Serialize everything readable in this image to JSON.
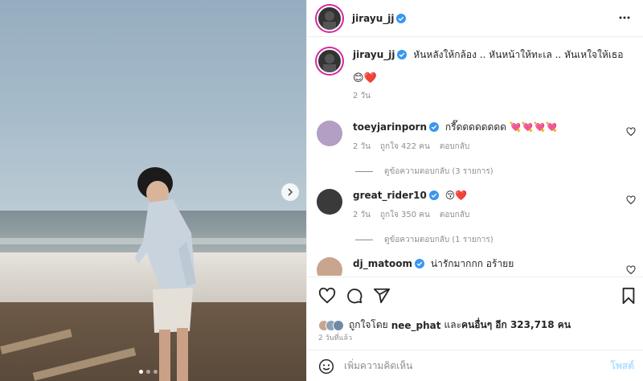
{
  "post": {
    "author": "jirayu_jj",
    "caption": "หันหลังให้กล้อง .. หันหน้าให้ทะเล .. หันเหใจให้เธอ",
    "caption_emojis": "😊❤️",
    "caption_time": "2 วัน",
    "carousel_dots": 3,
    "carousel_active": 1
  },
  "comments": [
    {
      "user": "toeyjarinporn",
      "text": "กรี๊ดดดดดดดด 💘💘💘💘",
      "time": "2 วัน",
      "likes": "ถูกใจ 422 คน",
      "reply": "ตอบกลับ",
      "view_replies": "ดูข้อความตอบกลับ (3 รายการ)"
    },
    {
      "user": "great_rider10",
      "text": "😚❤️",
      "time": "2 วัน",
      "likes": "ถูกใจ 350 คน",
      "reply": "ตอบกลับ",
      "view_replies": "ดูข้อความตอบกลับ (1 รายการ)"
    },
    {
      "user": "dj_matoom",
      "text": "น่ารักมากกก อร้ายย"
    }
  ],
  "likes_summary": {
    "prefix": "ถูกใจโดย",
    "user": "nee_phat",
    "middle": "และ",
    "others": "คนอื่นๆ อีก 323,718 คน"
  },
  "time_ago": "2 วันที่แล้ว",
  "add_comment": {
    "placeholder": "เพิ่มความคิดเห็น",
    "post_label": "โพสต์"
  },
  "colors": {
    "verified": "#3897f0",
    "heart": "#ed4956",
    "story_ring": "#d6249f",
    "post_button_disabled": "#b2dffc"
  }
}
